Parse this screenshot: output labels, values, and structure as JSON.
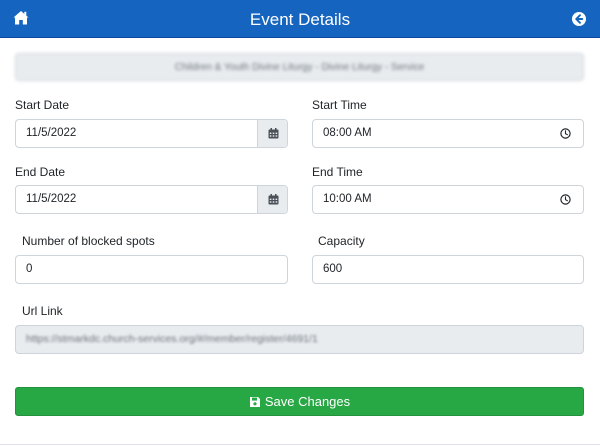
{
  "header": {
    "title": "Event Details",
    "background": "#1565c0"
  },
  "event": {
    "name": "Children & Youth Divine Liturgy - Divine Liturgy - Service"
  },
  "fields": {
    "start_date": {
      "label": "Start Date",
      "value": "11/5/2022"
    },
    "start_time": {
      "label": "Start Time",
      "value": "08:00 AM"
    },
    "end_date": {
      "label": "End Date",
      "value": "11/5/2022"
    },
    "end_time": {
      "label": "End Time",
      "value": "10:00 AM"
    },
    "blocked_spots": {
      "label": "Number of blocked spots",
      "value": "0"
    },
    "capacity": {
      "label": "Capacity",
      "value": "600"
    },
    "url_link": {
      "label": "Url Link",
      "value": "https://stmarkdc.church-services.org/#/member/register/4691/1"
    }
  },
  "actions": {
    "save_label": "Save Changes",
    "save_color": "#28a745"
  },
  "icons": {
    "home": "home-icon",
    "back": "circle-arrow-left-icon",
    "calendar": "calendar-icon",
    "clock": "clock-icon",
    "save": "floppy-disk-icon"
  }
}
